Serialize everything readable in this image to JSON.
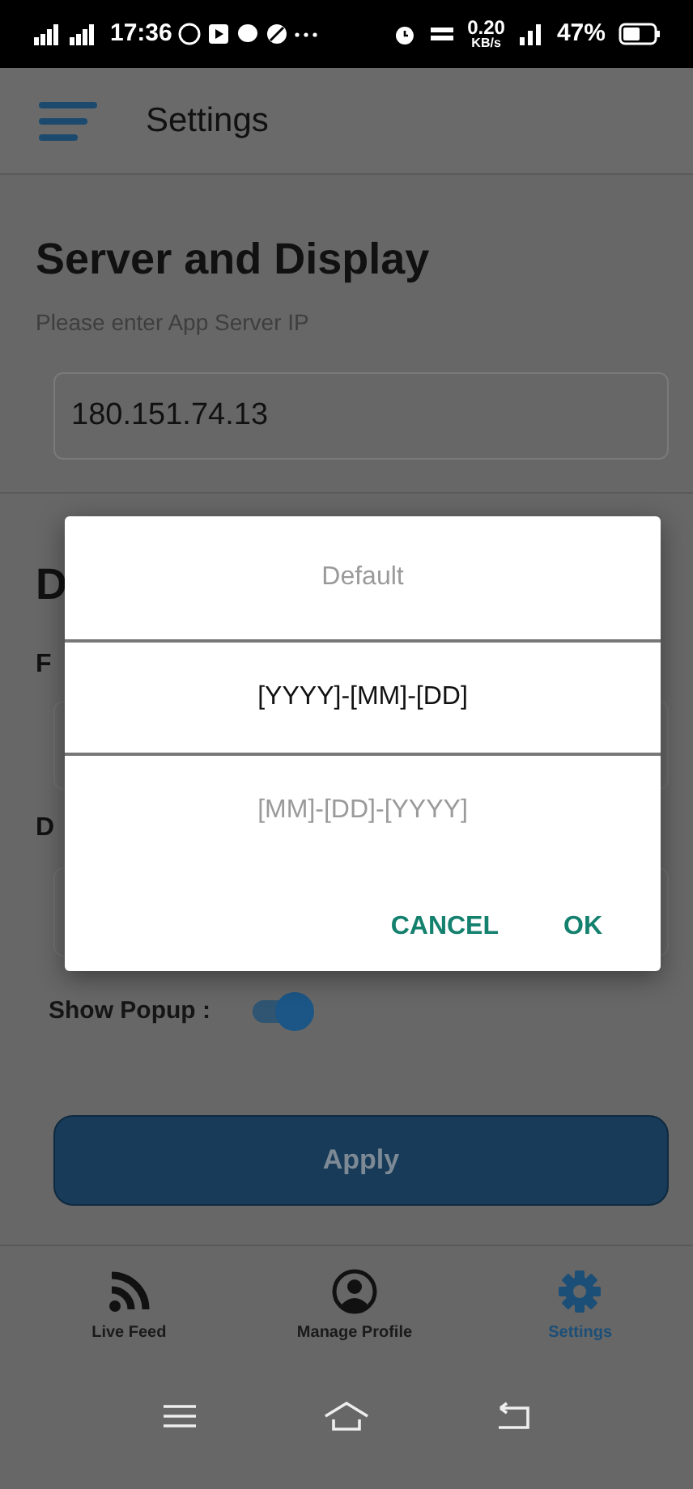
{
  "status_bar": {
    "time": "17:36",
    "speed": "0.20",
    "speed_unit": "KB/s",
    "battery": "47%"
  },
  "app_bar": {
    "title": "Settings"
  },
  "server": {
    "heading": "Server and Display",
    "hint": "Please enter App Server IP",
    "value": "180.151.74.13"
  },
  "hidden_section": {
    "heading": "D",
    "label_1": "F",
    "label_2": "D"
  },
  "show_popup": {
    "label": "Show Popup :",
    "on": true
  },
  "apply_button": "Apply",
  "bottom_nav": [
    {
      "kind": "feed",
      "label": "Live Feed",
      "selected": false
    },
    {
      "kind": "profile",
      "label": "Manage Profile",
      "selected": false
    },
    {
      "kind": "settings",
      "label": "Settings",
      "selected": true
    }
  ],
  "dialog": {
    "options": [
      {
        "label": "Default",
        "selected": false
      },
      {
        "label": "[YYYY]-[MM]-[DD]",
        "selected": true
      },
      {
        "label": "[MM]-[DD]-[YYYY]",
        "selected": false
      }
    ],
    "buttons": [
      "CANCEL",
      "OK"
    ]
  }
}
